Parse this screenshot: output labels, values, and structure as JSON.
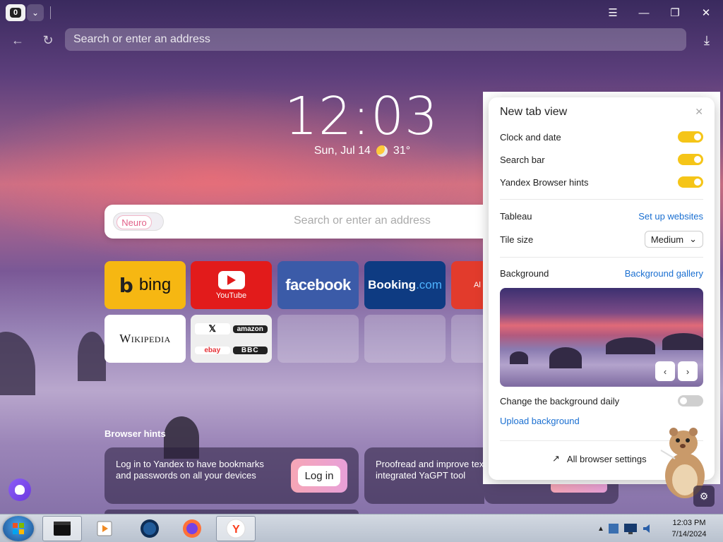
{
  "titlebar": {
    "tab_count": "0",
    "menu_icon": "hamburger-icon",
    "minimize_icon": "minimize-icon",
    "restore_icon": "restore-icon",
    "close_icon": "close-icon"
  },
  "addressbar": {
    "placeholder": "Search or enter an address"
  },
  "clock": {
    "time": "12:03",
    "date": "Sun, Jul 14",
    "temperature": "31°"
  },
  "search": {
    "neuro_label": "Neuro",
    "placeholder": "Search or enter an address"
  },
  "tiles": {
    "bing": "bing",
    "youtube": "YouTube",
    "facebook": "facebook",
    "booking": "Booking",
    "booking_suffix": ".com",
    "partial": "Al",
    "wikipedia": "Wikipedia",
    "group": [
      "𝕏",
      "amazon",
      "ebay",
      "BBC"
    ]
  },
  "hints": {
    "title": "Browser hints",
    "card1_line1": "Log in to Yandex to have bookmarks",
    "card1_line2": "and passwords on all your devices",
    "login_label": "Log in",
    "card2_line1": "Proofread and improve tex",
    "card2_line2": "integrated YaGPT tool"
  },
  "panel": {
    "title": "New tab view",
    "clock_date": "Clock and date",
    "search_bar": "Search bar",
    "yandex_hints": "Yandex Browser hints",
    "tableau": "Tableau",
    "set_up_websites": "Set up websites",
    "tile_size": "Tile size",
    "tile_size_value": "Medium",
    "background": "Background",
    "background_gallery": "Background gallery",
    "change_daily": "Change the background daily",
    "upload_background": "Upload background",
    "all_settings": "All browser settings",
    "toggles": {
      "clock_date": true,
      "search_bar": true,
      "yandex_hints": true,
      "change_daily": false
    }
  },
  "taskbar": {
    "time": "12:03 PM",
    "date": "7/14/2024"
  },
  "colors": {
    "toggle_on": "#f5c518",
    "link": "#1a6fd1",
    "youtube": "#e21b1b",
    "facebook": "#3b5ba8",
    "booking": "#0e3b82",
    "bing": "#f6b712"
  }
}
